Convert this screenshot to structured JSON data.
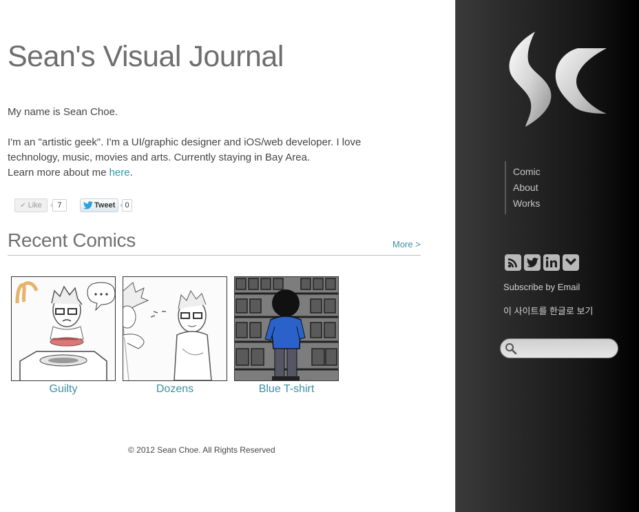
{
  "main": {
    "site_title": "Sean's Visual Journal",
    "intro": {
      "line1": "My name is Sean Choe.",
      "para2": "I'm an \"artistic geek\". I'm a UI/graphic designer and iOS/web developer. I love technology, music, movies and arts. Currently staying in Bay Area.",
      "learn_more_prefix": "Learn more about me ",
      "learn_more_link": "here",
      "learn_more_suffix": "."
    },
    "social": {
      "like_label": "Like",
      "like_count": "7",
      "tweet_label": "Tweet",
      "tweet_count": "0"
    },
    "recent": {
      "title": "Recent Comics",
      "more_label": "More >",
      "comics": [
        {
          "caption": "Guilty"
        },
        {
          "caption": "Dozens"
        },
        {
          "caption": "Blue T-shirt"
        }
      ]
    },
    "footer": "© 2012 Sean Choe. All Rights Reserved"
  },
  "sidebar": {
    "nav": [
      "Comic",
      "About",
      "Works"
    ],
    "social_icons": [
      "rss-icon",
      "twitter-icon",
      "linkedin-icon",
      "heart-icon"
    ],
    "subscribe_label": "Subscribe by Email",
    "korean_label": "이 사이트를 한글로 보기",
    "search_placeholder": ""
  },
  "colors": {
    "link": "#3a8fa3",
    "title_gray": "#6e6e6e",
    "sidebar_bg": "#1e1e1e"
  }
}
